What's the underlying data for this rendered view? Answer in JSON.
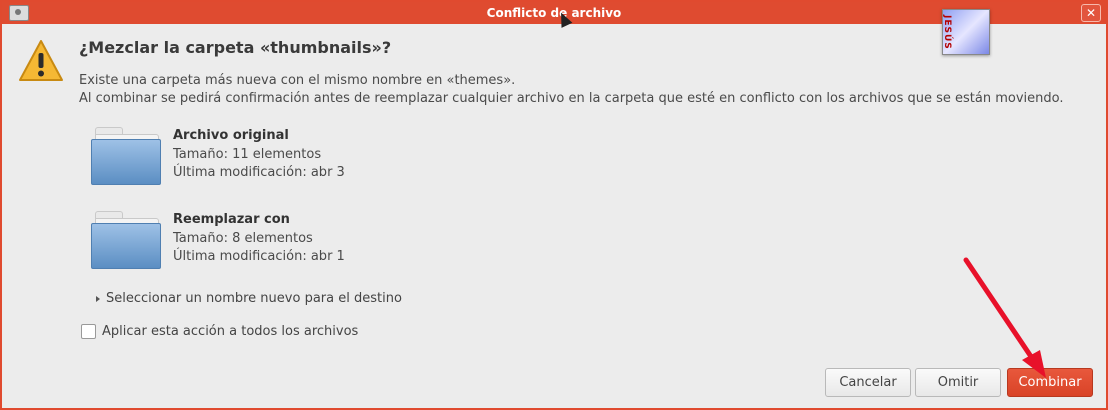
{
  "window": {
    "title": "Conflicto de archivo",
    "close_glyph": "✕"
  },
  "badge": {
    "text": "JESÚS"
  },
  "dialog": {
    "heading": "¿Mezclar la carpeta «thumbnails»?",
    "line1": "Existe una carpeta más nueva con el mismo nombre en «themes».",
    "line2": "Al combinar se pedirá confirmación antes de reemplazar cualquier archivo en la carpeta que esté en conflicto con los archivos que se están moviendo."
  },
  "original": {
    "name": "Archivo original",
    "size": "Tamaño: 11 elementos",
    "modified": "Última modificación: abr 3"
  },
  "replacement": {
    "name": "Reemplazar con",
    "size": "Tamaño: 8 elementos",
    "modified": "Última modificación: abr 1"
  },
  "rename_expander": "Seleccionar un nombre nuevo para el destino",
  "apply_all": "Aplicar esta acción a todos los archivos",
  "buttons": {
    "cancel": "Cancelar",
    "skip": "Omitir",
    "merge": "Combinar"
  },
  "colors": {
    "accent": "#df4b30",
    "folder": "#6f9fd0",
    "annotation_arrow": "#e8112a"
  },
  "icons": {
    "warning": "warning-icon",
    "folder": "folder-icon"
  }
}
